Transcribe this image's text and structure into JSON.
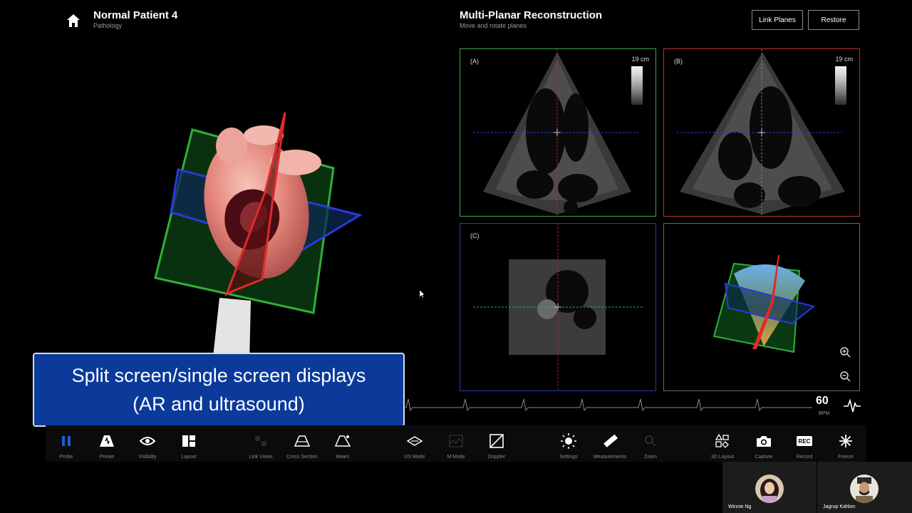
{
  "header": {
    "patient_title": "Normal Patient 4",
    "patient_subtitle": "Pathology",
    "mpr_title": "Multi-Planar Reconstruction",
    "mpr_subtitle": "Move and rotate planes",
    "link_planes_label": "Link Planes",
    "restore_label": "Restore"
  },
  "panels": {
    "a": {
      "label": "(A)",
      "depth": "19 cm",
      "border": "#3aa84a"
    },
    "b": {
      "label": "(B)",
      "depth": "19 cm",
      "border": "#b83232"
    },
    "c": {
      "label": "(C)",
      "border": "#2a3aa8"
    },
    "d": {
      "border": "#6a6a6a"
    }
  },
  "caption": {
    "line1": "Split screen/single screen displays",
    "line2": "(AR and ultrasound)"
  },
  "heart_rate": {
    "value": "60",
    "unit": "BPM"
  },
  "toolbar": {
    "probe": "Probe",
    "preset": "Preset",
    "visibility": "Visibility",
    "layout": "Layout",
    "link_views": "Link Views",
    "cross_section": "Cross Section",
    "beam": "Beam",
    "us_mode": "US Mode",
    "m_mode": "M Mode",
    "doppler": "Doppler",
    "settings": "Settings",
    "measurements": "Measurements",
    "zoom": "Zoom",
    "layout_3d": "3D Layout",
    "capture": "Capture",
    "record": "Record",
    "record_badge": "REC",
    "freeze": "Freeze"
  },
  "participants": [
    "Winnie Ng",
    "Jagrup Kahlon"
  ],
  "colors": {
    "accent": "#1a5fd0",
    "plane_green": "#2fb03a",
    "plane_red": "#e02a2a",
    "plane_blue": "#2a3ad8",
    "caption_bg": "#0b3a9a"
  }
}
